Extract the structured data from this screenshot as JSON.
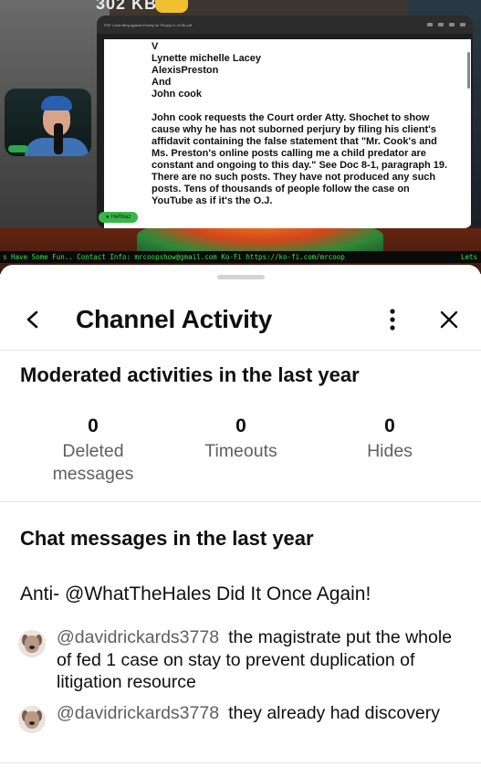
{
  "video": {
    "top_cut_text": "302 KB",
    "doc_filename": "PDF Cook filing against Family for Perjury in ch 6b.pdf",
    "doc_lines": [
      "V",
      "Lynette michelle Lacey",
      "AlexisPreston",
      "And",
      "John cook"
    ],
    "doc_paragraph": "John cook requests the Court order Atty. Shochet to show cause why he has not suborned perjury by filing his client's affidavit containing the false statement that \"Mr. Cook's and Ms. Preston's online posts calling me a child predator are constant and ongoing to this day.\" See Doc 8-1, paragraph 19. There are no such posts. They have not produced any such posts. Tens of thousands of people follow the case on YouTube as if it's the O.J.",
    "pill_label": "HeRbaz",
    "ticker_text": "s Have Some Fun.. Contact Info: mrcoopshow@gmail.com Ko-Fi https://ko-fi.com/mrcoop",
    "ticker_end": "Lets"
  },
  "sheet": {
    "title": "Channel Activity",
    "back_icon": "chevron-left-icon",
    "more_icon": "more-vertical-icon",
    "close_icon": "close-icon",
    "moderated": {
      "heading": "Moderated activities in the last year",
      "stats": [
        {
          "value": "0",
          "label": "Deleted messages"
        },
        {
          "value": "0",
          "label": "Timeouts"
        },
        {
          "value": "0",
          "label": "Hides"
        }
      ]
    },
    "chat": {
      "heading": "Chat messages in the last year",
      "pinned": "Anti- @WhatTheHales Did It Once Again!",
      "messages": [
        {
          "author": "@davidrickards3778",
          "text": "the magistrate put the whole of fed 1 case on stay to prevent duplication of litigation resource"
        },
        {
          "author": "@davidrickards3778",
          "text": "they already had discovery"
        }
      ]
    }
  }
}
